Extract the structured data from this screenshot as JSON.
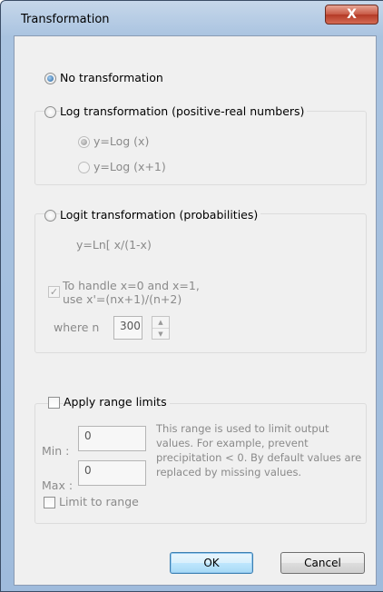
{
  "window": {
    "title": "Transformation",
    "close_glyph": "X"
  },
  "options": {
    "no_transform": {
      "label": "No transformation",
      "checked": true
    },
    "log": {
      "label": "Log transformation (positive-real numbers)",
      "checked": false,
      "sub": [
        {
          "label": "y=Log (x)",
          "checked": true,
          "enabled": false
        },
        {
          "label": "y=Log (x+1)",
          "checked": false,
          "enabled": false
        }
      ]
    },
    "logit": {
      "label": "Logit transformation (probabilities)",
      "checked": false,
      "formula": "y=Ln[ x/(1-x)",
      "handle_line1": "To handle x=0 and x=1,",
      "handle_line2": "use x'=(nx+1)/(n+2)",
      "handle_checked": true,
      "where_label": "where n",
      "n_value": "300"
    }
  },
  "range": {
    "label": "Apply range limits",
    "checked": false,
    "min_label": "Min :",
    "min_value": "0",
    "max_label": "Max :",
    "max_value": "0",
    "description": "This range is used to limit output values. For example, prevent precipitation < 0. By default values are replaced by missing values.",
    "limit_label": "Limit to range",
    "limit_checked": false
  },
  "buttons": {
    "ok": "OK",
    "cancel": "Cancel"
  }
}
